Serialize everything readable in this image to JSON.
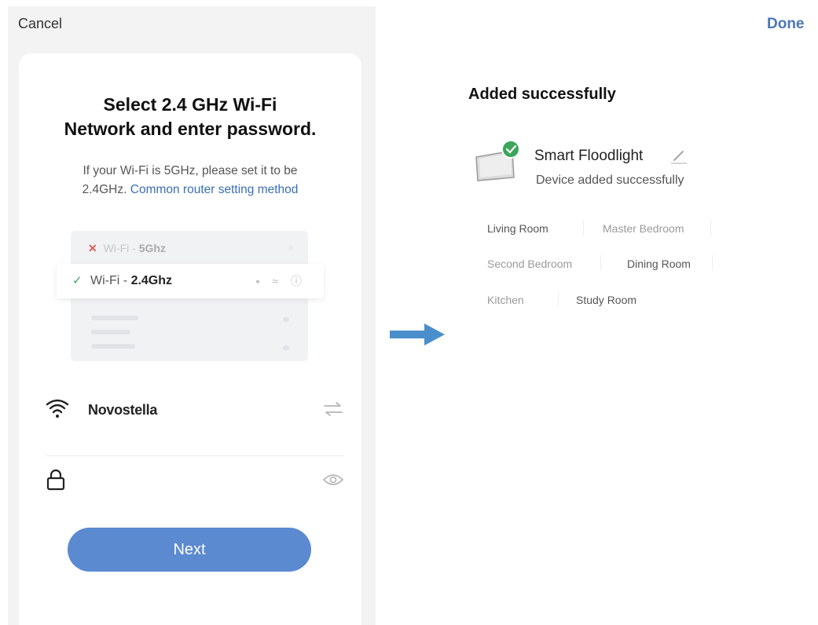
{
  "left": {
    "cancel_label": "Cancel",
    "title_line1": "Select 2.4 GHz Wi-Fi",
    "title_line2": "Network and enter password.",
    "subtitle_line1": "If your Wi-Fi is 5GHz, please set it to be",
    "subtitle_line2_prefix": "2.4GHz.",
    "subtitle_link": "Common router setting method",
    "illustration": {
      "row1_prefix": "Wi-Fi - ",
      "row1_band": "5Ghz",
      "row2_prefix": "Wi-Fi - ",
      "row2_band": "2.4Ghz"
    },
    "ssid": "Novostella",
    "password_value": "",
    "next_label": "Next"
  },
  "right": {
    "done_label": "Done",
    "added_title": "Added successfully",
    "device_name": "Smart Floodlight",
    "device_status": "Device added successfully",
    "rooms": [
      "Living Room",
      "Master Bedroom",
      "Second Bedroom",
      "Dining Room",
      "Kitchen",
      "Study Room"
    ]
  },
  "colors": {
    "accent": "#5b8ad1",
    "link": "#3a6fb3",
    "done": "#4a77b8",
    "arrow": "#4a8fcc",
    "success": "#3ba55c",
    "error": "#e25a5a"
  },
  "icons": [
    "wifi-icon",
    "switch-network-icon",
    "lock-icon",
    "eye-icon",
    "arrow-right-icon",
    "edit-pencil-icon",
    "check-badge-icon"
  ]
}
